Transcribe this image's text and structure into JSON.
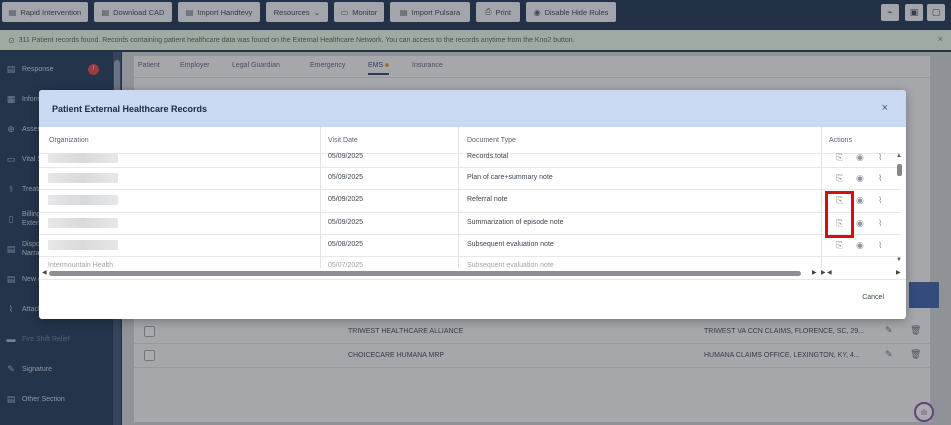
{
  "toolbar": {
    "buttons": [
      {
        "label": "Rapid Intervention",
        "icon": "document-icon"
      },
      {
        "label": "Download CAD",
        "icon": "download-icon"
      },
      {
        "label": "Import Handtevy",
        "icon": "import-icon"
      },
      {
        "label": "Resources",
        "icon": "chevron-down-icon"
      },
      {
        "label": "Monitor",
        "icon": "monitor-icon"
      },
      {
        "label": "Import Pulsara",
        "icon": "import-icon"
      },
      {
        "label": "Print",
        "icon": "print-icon"
      },
      {
        "label": "Disable Hide Rules",
        "icon": "eye-icon"
      }
    ]
  },
  "notice": {
    "text": "311 Patient records found. Records containing patient healthcare data was found on the External Healthcare Network. You can access to the records anytime from the Kno2 button."
  },
  "sidebar": {
    "items": [
      {
        "label": "Response",
        "badge": "!"
      },
      {
        "label": "Inform"
      },
      {
        "label": "Asses"
      },
      {
        "label": "Vital S"
      },
      {
        "label": "Treatm"
      },
      {
        "label": "Billing",
        "label2": "Exterr"
      },
      {
        "label": "Dispo",
        "label2": "Narrat"
      },
      {
        "label": "New o"
      },
      {
        "label": "Attach"
      },
      {
        "label": "Fire Shift Relief"
      },
      {
        "label": "Signature"
      },
      {
        "label": "Other Section"
      }
    ]
  },
  "tabs": [
    {
      "label": "Patient"
    },
    {
      "label": "Employer"
    },
    {
      "label": "Legal Guardian"
    },
    {
      "label": "Emergency"
    },
    {
      "label": "EMS"
    },
    {
      "label": "Insurance"
    }
  ],
  "bg_rows": [
    {
      "org": "TRIWEST HEALTHCARE ALLIANCE",
      "addr": "TRIWEST VA CCN CLAIMS, FLORENCE, SC, 29..."
    },
    {
      "org": "CHOICECARE HUMANA MRP",
      "addr": "HUMANA CLAIMS OFFICE, LEXINGTON, KY, 4..."
    }
  ],
  "modal": {
    "title": "Patient External Healthcare Records",
    "close": "×",
    "columns": {
      "org": "Organization",
      "date": "Visit Date",
      "type": "Document Type",
      "actions": "Actions"
    },
    "rows": [
      {
        "date": "05/09/2025",
        "type": "Records.total"
      },
      {
        "date": "05/09/2025",
        "type": "Plan of care+summary note"
      },
      {
        "date": "05/09/2025",
        "type": "Referral note"
      },
      {
        "date": "05/09/2025",
        "type": "Summarization of episode note"
      },
      {
        "date": "05/08/2025",
        "type": "Subsequent evaluation note"
      }
    ],
    "cutoff_row": {
      "org": "Intermountain Health",
      "date": "05/07/2025",
      "type": "Subsequent evaluation note"
    },
    "cancel": "Cancel"
  }
}
